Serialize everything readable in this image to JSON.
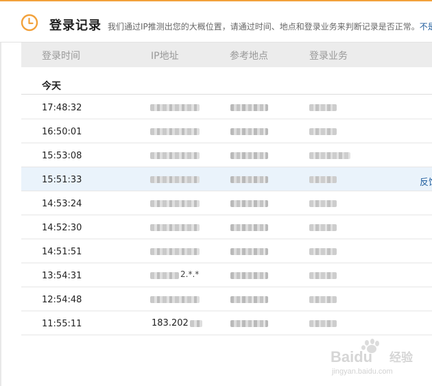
{
  "header": {
    "title": "登录记录",
    "subtitle": "我们通过IP推测出您的大概位置，请通过时间、地点和登录业务来判断记录是否正常。",
    "subtitle_more": "不是",
    "icon": "clock-icon",
    "accent_color": "#f2a13a"
  },
  "table": {
    "columns": [
      "登录时间",
      "IP地址",
      "参考地点",
      "登录业务"
    ],
    "group_label": "今天",
    "highlight_color": "#eaf3fb",
    "rows": [
      {
        "time": "17:48:32"
      },
      {
        "time": "16:50:01"
      },
      {
        "time": "15:53:08"
      },
      {
        "time": "15:51:33",
        "action": "反馈"
      },
      {
        "time": "14:53:24"
      },
      {
        "time": "14:52:30"
      },
      {
        "time": "14:51:51"
      },
      {
        "time": "13:54:31",
        "ip_partial": "2.*.*"
      },
      {
        "time": "12:54:48"
      },
      {
        "time": "11:55:11",
        "ip_partial": "183.202"
      }
    ]
  },
  "watermark": {
    "brand": "Baidu",
    "brand_suffix": "经验",
    "url": "jingyan.baidu.com"
  }
}
